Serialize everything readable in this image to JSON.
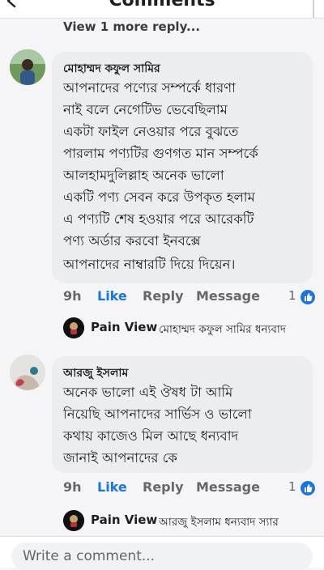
{
  "header": {
    "title": "Comments"
  },
  "view_more": "View 1 more reply...",
  "comments": [
    {
      "author": "মোহাম্মদ কফুল সামির",
      "lines": [
        "আপনাদের পণ্যের সম্পর্কে ধারণা",
        "নাই বলে নেগেটিভ ভেবেছিলাম",
        "একটা ফাইল নেওয়ার পরে বুঝতে",
        "পারলাম পণ্যটির গুণগত মান সম্পর্কে",
        "আলহামদুলিল্লাহ অনেক ভালো",
        "একটি পণ্য সেবন করে উপকৃত হলাম",
        "এ পণ্যটি শেষ হওয়ার পরে আরেকটি",
        "পণ্য অর্ডার করবো ইনবক্সে",
        "আপনাদের নাম্বারটি দিয়ে দিয়েন।"
      ],
      "time": "9h",
      "like": "Like",
      "reply": "Reply",
      "message": "Message",
      "reaction_count": "1",
      "reply_preview": {
        "name": "Pain View",
        "text": "মোহাম্মদ কফুল সামির ধন্যবাদ"
      }
    },
    {
      "author": "আরজু ইসলাম",
      "lines": [
        "অনেক ভালো এই ঔষধ টা আমি",
        "নিয়েছি আপনাদের  সার্ভিস ও ভালো",
        "কথায় কাজেও মিল আছে ধন্যবাদ",
        "জানাই আপনাদের কে"
      ],
      "time": "9h",
      "like": "Like",
      "reply": "Reply",
      "message": "Message",
      "reaction_count": "1",
      "reply_preview": {
        "name": "Pain View",
        "text": "আরজু ইসলাম ধন্যবাদ স্যার"
      }
    }
  ],
  "input": {
    "placeholder": "Write a comment..."
  },
  "colors": {
    "like_blue": "#1b74e4",
    "bubble": "#ebedf0",
    "meta_gray": "#65676b"
  },
  "icons": [
    "back-arrow-icon",
    "like-thumb-icon",
    "avatar-photo",
    "pain-view-logo"
  ]
}
